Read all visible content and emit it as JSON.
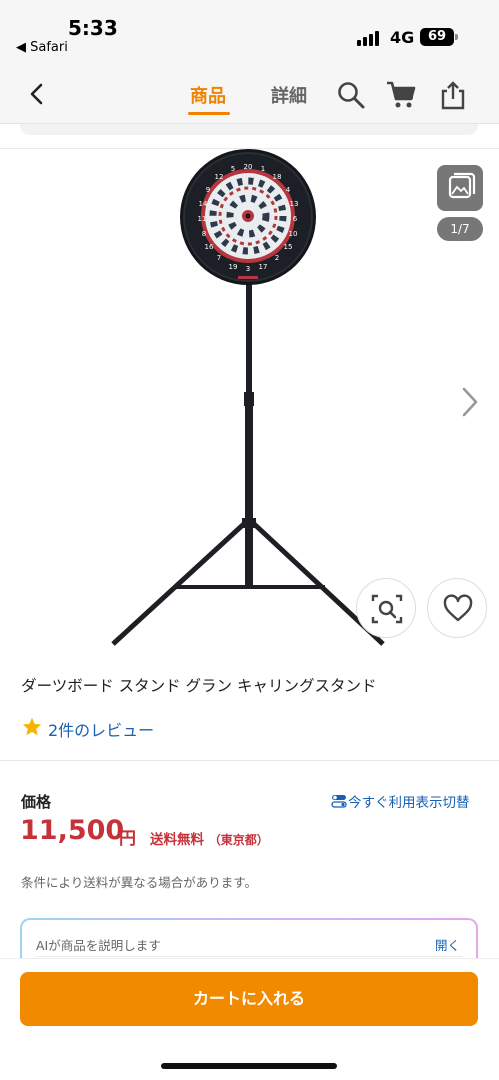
{
  "status_bar": {
    "time": "5:33",
    "back_app": "◀ Safari",
    "network": "4G",
    "battery": "69"
  },
  "nav": {
    "tabs": [
      {
        "label": "商品",
        "active": true
      },
      {
        "label": "詳細",
        "active": false
      }
    ],
    "icons": [
      "back-chevron-icon",
      "search-icon",
      "cart-icon",
      "share-icon"
    ],
    "accent_color": "#f08300"
  },
  "gallery": {
    "counter": "1/7"
  },
  "product": {
    "title": "ダーツボード スタンド グラン キャリングスタンド",
    "review_text": "2件のレビュー"
  },
  "price_section": {
    "label": "価格",
    "toggle_text": "今すぐ利用表示切替",
    "price": "11,500",
    "price_unit": "円",
    "shipping": "送料無料",
    "shipping_region": "（東京都）",
    "note": "条件により送料が異なる場合があります。",
    "price_color": "#c6323a"
  },
  "ai_summary": {
    "text": "AIが商品を説明します",
    "open_label": "開く"
  },
  "cart": {
    "button_label": "カートに入れる",
    "button_color": "#f28a00"
  }
}
